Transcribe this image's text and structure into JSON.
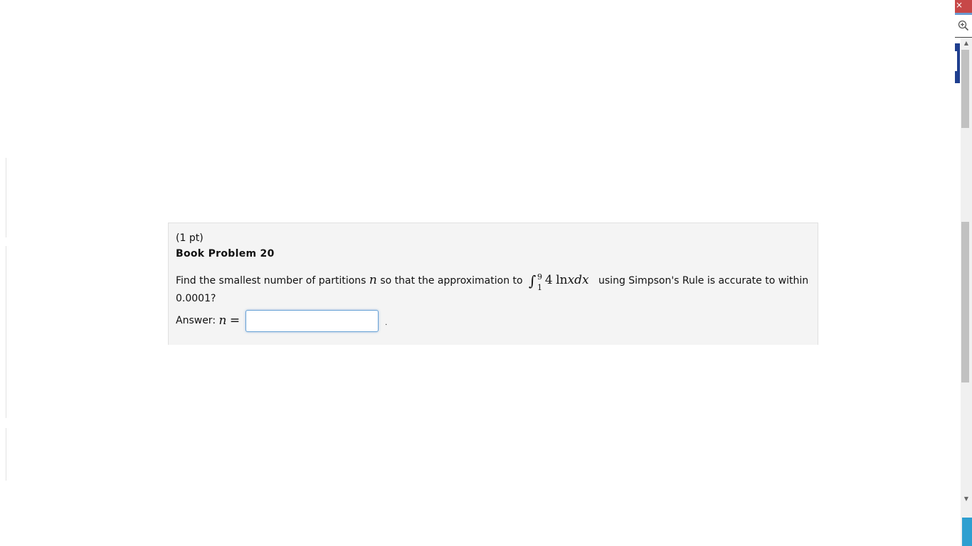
{
  "problem": {
    "points": "(1 pt)",
    "title": "Book Problem 20",
    "text_before_var": "Find the smallest number of partitions",
    "variable": "n",
    "text_after_var": "so that the approximation to",
    "integral": {
      "lower": "1",
      "upper": "9",
      "coefficient": "4",
      "function": "ln",
      "integrand_var": "x",
      "differential": "dx"
    },
    "text_after_integral": "using Simpson's Rule is accurate to within",
    "tolerance": "0.0001?",
    "answer_label": "Answer:",
    "answer_var": "n",
    "answer_equals": "=",
    "answer_value": "",
    "answer_period": "."
  },
  "sidebar": {
    "close_glyph": "×",
    "zoom_glyph": "⊕",
    "scroll_up_glyph": "▲",
    "scroll_down_glyph": "▼"
  },
  "colors": {
    "close_button": "#c74848",
    "side_tab": "#1f3f8f",
    "side_bottom": "#2e9fd0",
    "input_focus": "#6aa3d6"
  },
  "icons": [
    "close-icon",
    "zoom-in-icon",
    "scroll-up-arrow-icon",
    "scroll-down-arrow-icon"
  ]
}
